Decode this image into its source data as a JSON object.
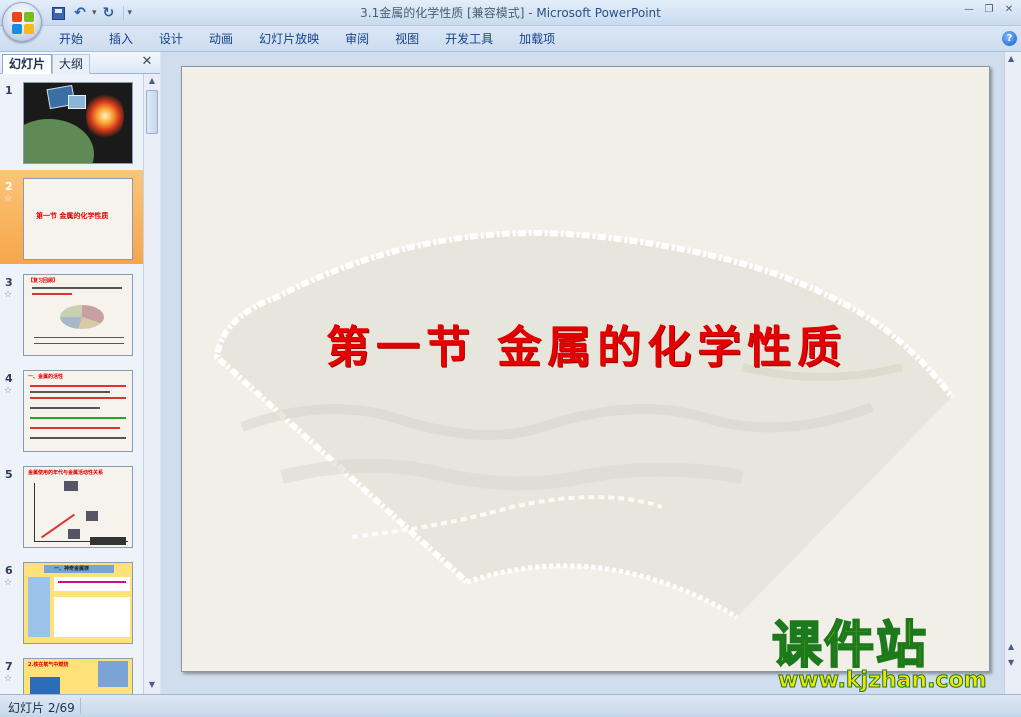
{
  "window": {
    "title_doc": "3.1金属的化学性质 [兼容模式]",
    "title_sep": " - ",
    "title_app": "Microsoft PowerPoint"
  },
  "ribbon": {
    "tabs": [
      "开始",
      "插入",
      "设计",
      "动画",
      "幻灯片放映",
      "审阅",
      "视图",
      "开发工具",
      "加载项"
    ]
  },
  "left_pane": {
    "tab_slides": "幻灯片",
    "tab_outline": "大纲",
    "slides": [
      {
        "num": "1"
      },
      {
        "num": "2",
        "title": "第一节 金属的化学性质"
      },
      {
        "num": "3",
        "title": "【复习回顾】"
      },
      {
        "num": "4",
        "title": "一、金属的活性"
      },
      {
        "num": "5",
        "title": "金属使用的年代与金属活动性关系"
      },
      {
        "num": "6",
        "title": "一、神奇金属镁"
      },
      {
        "num": "7",
        "title": "2.铁在氧气中燃烧"
      }
    ]
  },
  "slide": {
    "title": "第一节 金属的化学性质"
  },
  "watermark": {
    "text": "课件站",
    "url": "www.kjzhan.com"
  },
  "status": {
    "slide_info": "幻灯片 2/69"
  }
}
